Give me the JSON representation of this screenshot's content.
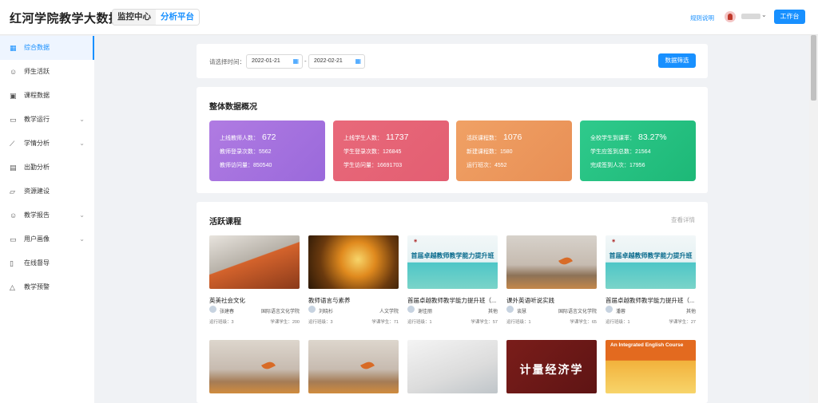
{
  "app": {
    "title": "红河学院教学大数据",
    "tabs": [
      "监控中心",
      "分析平台"
    ],
    "active_tab": "分析平台",
    "guide_link": "规则说明",
    "workbench_button": "工作台"
  },
  "sidebar": {
    "items": [
      {
        "label": "综合数据",
        "icon": "grid-icon",
        "active": true
      },
      {
        "label": "师生活跃",
        "icon": "user-icon"
      },
      {
        "label": "课程数据",
        "icon": "book-icon"
      },
      {
        "label": "教学运行",
        "icon": "monitor-icon",
        "expandable": true
      },
      {
        "label": "学情分析",
        "icon": "line-chart-icon",
        "expandable": true
      },
      {
        "label": "出勤分析",
        "icon": "calendar-icon"
      },
      {
        "label": "资源建设",
        "icon": "folder-icon"
      },
      {
        "label": "教学报告",
        "icon": "user-icon",
        "expandable": true
      },
      {
        "label": "用户画像",
        "icon": "monitor-icon",
        "expandable": true
      },
      {
        "label": "在线督导",
        "icon": "clipboard-icon"
      },
      {
        "label": "教学预警",
        "icon": "bell-icon"
      }
    ]
  },
  "filter": {
    "label": "请选择时间：",
    "start_date": "2022-01-21",
    "end_date": "2022-02-21",
    "separator": "-",
    "button": "数据筛选"
  },
  "overview": {
    "title": "整体数据概况",
    "cards": [
      {
        "color": "#a774e0",
        "rows": [
          [
            "上线教师人数：",
            "672"
          ],
          [
            "教师登录次数：",
            "5562"
          ],
          [
            "教师访问量：",
            "850540"
          ]
        ]
      },
      {
        "color": "#e6647a",
        "rows": [
          [
            "上线学生人数：",
            "11737"
          ],
          [
            "学生登录次数：",
            "126845"
          ],
          [
            "学生访问量：",
            "16691703"
          ]
        ]
      },
      {
        "color": "#ec9a5e",
        "rows": [
          [
            "活跃课程数：",
            "1076"
          ],
          [
            "新建课程数：",
            "1580"
          ],
          [
            "运行班次：",
            "4552"
          ]
        ]
      },
      {
        "color": "#25c282",
        "rows": [
          [
            "全校学生到课率：",
            "83.27%"
          ],
          [
            "学生应签到总数：",
            "21564"
          ],
          [
            "完成签到人次：",
            "17956"
          ]
        ]
      }
    ]
  },
  "courses": {
    "title": "活跃课程",
    "more": "查看详情",
    "items": [
      {
        "title": "英美社会文化",
        "teacher": "张建春",
        "dept": "国际语言文化学院",
        "classes": "运行班级：3",
        "students": "学课学生：200",
        "img": "i1"
      },
      {
        "title": "教师语言与素养",
        "teacher": "刘晓杉",
        "dept": "人文学院",
        "classes": "运行班级：3",
        "students": "学课学生：71",
        "img": "i2"
      },
      {
        "title": "首届卓越教师教学能力提升班（...",
        "teacher": "谢佳丽",
        "dept": "其他",
        "classes": "运行班级：1",
        "students": "学课学生：57",
        "img": "i3",
        "banner": "首届卓越教师教学能力提升班"
      },
      {
        "title": "课外英语听说实践",
        "teacher": "谈慧",
        "dept": "国际语言文化学院",
        "classes": "运行班级：1",
        "students": "学课学生：65",
        "img": "i4"
      },
      {
        "title": "首届卓越教师教学能力提升班（...",
        "teacher": "潘蓉",
        "dept": "其他",
        "classes": "运行班级：1",
        "students": "学课学生：27",
        "img": "i5",
        "banner": "首届卓越教师教学能力提升班"
      },
      {
        "title": "",
        "img": "i6"
      },
      {
        "title": "",
        "img": "i7"
      },
      {
        "title": "",
        "img": "i8"
      },
      {
        "title": "",
        "img": "i9",
        "banner": "计量经济学"
      },
      {
        "title": "",
        "img": "i10",
        "banner": "An Integrated English Course"
      }
    ]
  },
  "colors": {
    "primary": "#1890ff"
  }
}
